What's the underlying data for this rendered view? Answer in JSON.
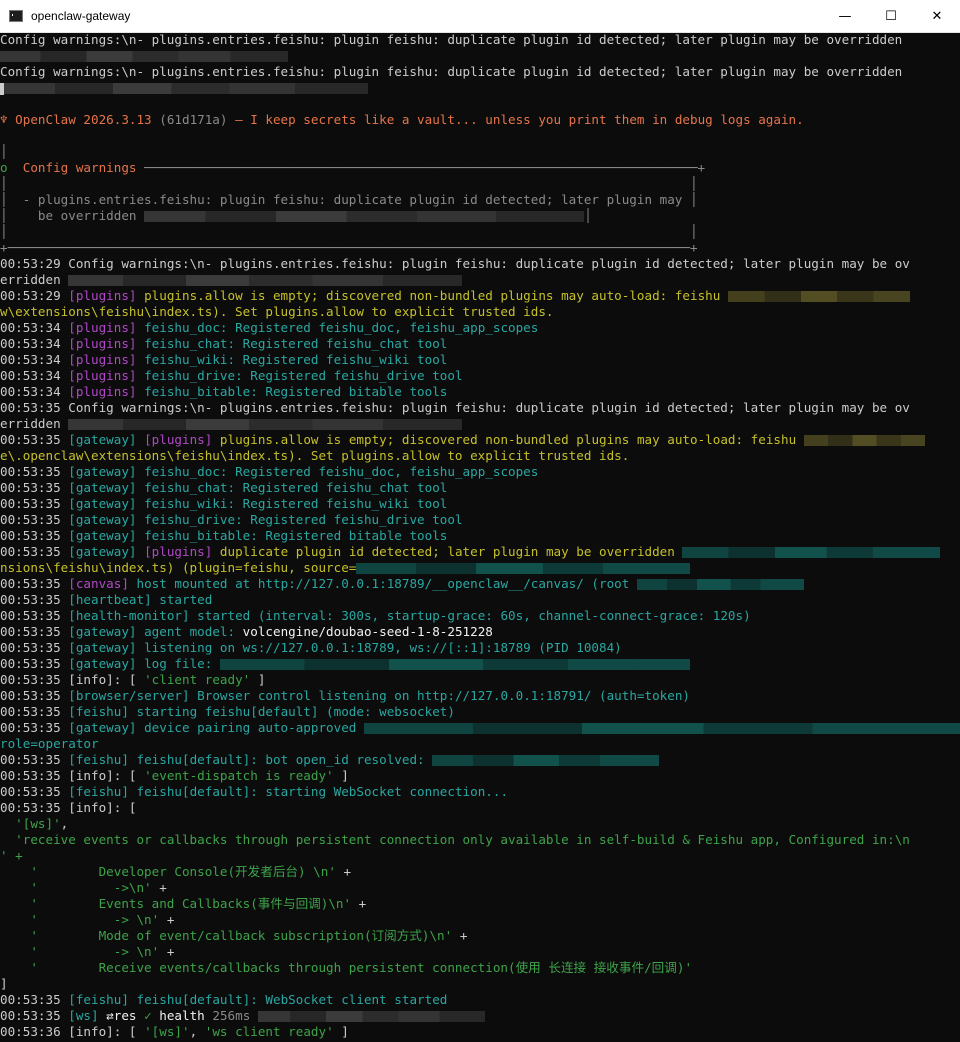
{
  "window": {
    "title": "openclaw-gateway",
    "minimize": "—",
    "maximize": "☐",
    "close": "✕"
  },
  "lines": [
    {
      "segs": [
        {
          "t": "Config warnings:\\n- plugins.entries.feishu: plugin feishu: duplicate plugin id detected; later plugin may be overridden"
        }
      ]
    },
    {
      "segs": [
        {
          "b": 38,
          "c": "gray"
        }
      ]
    },
    {
      "segs": [
        {
          "t": "Config warnings:\\n- plugins.entries.feishu: plugin feishu: duplicate plugin id detected; later plugin may be overridden"
        }
      ]
    },
    {
      "segs": [
        {
          "cursor": true
        },
        {
          "b": 48,
          "c": "gray"
        }
      ]
    },
    {
      "segs": []
    },
    {
      "segs": [
        {
          "t": "♆ OpenClaw 2026.3.13 ",
          "c": "orange"
        },
        {
          "t": "(61d171a)",
          "c": "gray"
        },
        {
          "t": " — I keep secrets like a vault... unless you print them in debug logs again.",
          "c": "orange"
        }
      ]
    },
    {
      "segs": []
    },
    {
      "segs": [
        {
          "t": "│",
          "c": "gray"
        }
      ]
    },
    {
      "segs": [
        {
          "t": "o  ",
          "c": "green"
        },
        {
          "t": "Config warnings",
          "c": "orange"
        },
        {
          "t": " ─────────────────────────────────────────────────────────────────────────+",
          "c": "gray"
        }
      ]
    },
    {
      "segs": [
        {
          "t": "│                                                                                          │",
          "c": "gray"
        }
      ]
    },
    {
      "segs": [
        {
          "t": "│  - plugins.entries.feishu: plugin feishu: duplicate plugin id detected; later plugin may │",
          "c": "gray"
        }
      ]
    },
    {
      "segs": [
        {
          "t": "│    be overridden ",
          "c": "gray"
        },
        {
          "b": 58,
          "c": "gray"
        },
        {
          "t": "│",
          "c": "gray"
        }
      ]
    },
    {
      "segs": [
        {
          "t": "│                                                                                          │",
          "c": "gray"
        }
      ]
    },
    {
      "segs": [
        {
          "t": "+──────────────────────────────────────────────────────────────────────────────────────────+",
          "c": "gray"
        }
      ]
    },
    {
      "segs": [
        {
          "t": "00:53:29 "
        },
        {
          "t": "Config warnings:\\n- plugins.entries.feishu: plugin feishu: duplicate plugin id detected; later plugin may be ov"
        }
      ]
    },
    {
      "segs": [
        {
          "t": "erridden "
        },
        {
          "b": 52,
          "c": "gray"
        }
      ]
    },
    {
      "segs": [
        {
          "t": "00:53:29 "
        },
        {
          "t": "[plugins]",
          "c": "plugins"
        },
        {
          "t": " plugins.allow is empty; discovered non-bundled plugins may auto-load: feishu ",
          "c": "yellow"
        },
        {
          "b": 24,
          "c": "olive"
        }
      ]
    },
    {
      "segs": [
        {
          "t": "w\\extensions\\feishu\\index.ts). Set plugins.allow to explicit trusted ids.",
          "c": "yellow"
        }
      ]
    },
    {
      "segs": [
        {
          "t": "00:53:34 "
        },
        {
          "t": "[plugins]",
          "c": "plugins"
        },
        {
          "t": " feishu_doc: Registered feishu_doc, feishu_app_scopes",
          "c": "gateway"
        }
      ]
    },
    {
      "segs": [
        {
          "t": "00:53:34 "
        },
        {
          "t": "[plugins]",
          "c": "plugins"
        },
        {
          "t": " feishu_chat: Registered feishu_chat tool",
          "c": "gateway"
        }
      ]
    },
    {
      "segs": [
        {
          "t": "00:53:34 "
        },
        {
          "t": "[plugins]",
          "c": "plugins"
        },
        {
          "t": " feishu_wiki: Registered feishu_wiki tool",
          "c": "gateway"
        }
      ]
    },
    {
      "segs": [
        {
          "t": "00:53:34 "
        },
        {
          "t": "[plugins]",
          "c": "plugins"
        },
        {
          "t": " feishu_drive: Registered feishu_drive tool",
          "c": "gateway"
        }
      ]
    },
    {
      "segs": [
        {
          "t": "00:53:34 "
        },
        {
          "t": "[plugins]",
          "c": "plugins"
        },
        {
          "t": " feishu_bitable: Registered bitable tools",
          "c": "gateway"
        }
      ]
    },
    {
      "segs": [
        {
          "t": "00:53:35 "
        },
        {
          "t": "Config warnings:\\n- plugins.entries.feishu: plugin feishu: duplicate plugin id detected; later plugin may be ov"
        }
      ]
    },
    {
      "segs": [
        {
          "t": "erridden "
        },
        {
          "b": 52,
          "c": "gray"
        }
      ]
    },
    {
      "segs": [
        {
          "t": "00:53:35 "
        },
        {
          "t": "[gateway]",
          "c": "gateway"
        },
        {
          "t": " "
        },
        {
          "t": "[plugins]",
          "c": "plugins"
        },
        {
          "t": " plugins.allow is empty; discovered non-bundled plugins may auto-load: feishu ",
          "c": "yellow"
        },
        {
          "b": 16,
          "c": "olive"
        }
      ]
    },
    {
      "segs": [
        {
          "t": "e\\.openclaw\\extensions\\feishu\\index.ts). Set plugins.allow to explicit trusted ids.",
          "c": "yellow"
        }
      ]
    },
    {
      "segs": [
        {
          "t": "00:53:35 "
        },
        {
          "t": "[gateway]",
          "c": "gateway"
        },
        {
          "t": " feishu_doc: Registered feishu_doc, feishu_app_scopes",
          "c": "gateway"
        }
      ]
    },
    {
      "segs": [
        {
          "t": "00:53:35 "
        },
        {
          "t": "[gateway]",
          "c": "gateway"
        },
        {
          "t": " feishu_chat: Registered feishu_chat tool",
          "c": "gateway"
        }
      ]
    },
    {
      "segs": [
        {
          "t": "00:53:35 "
        },
        {
          "t": "[gateway]",
          "c": "gateway"
        },
        {
          "t": " feishu_wiki: Registered feishu_wiki tool",
          "c": "gateway"
        }
      ]
    },
    {
      "segs": [
        {
          "t": "00:53:35 "
        },
        {
          "t": "[gateway]",
          "c": "gateway"
        },
        {
          "t": " feishu_drive: Registered feishu_drive tool",
          "c": "gateway"
        }
      ]
    },
    {
      "segs": [
        {
          "t": "00:53:35 "
        },
        {
          "t": "[gateway]",
          "c": "gateway"
        },
        {
          "t": " feishu_bitable: Registered bitable tools",
          "c": "gateway"
        }
      ]
    },
    {
      "segs": [
        {
          "t": "00:53:35 "
        },
        {
          "t": "[gateway]",
          "c": "gateway"
        },
        {
          "t": " "
        },
        {
          "t": "[plugins]",
          "c": "plugins"
        },
        {
          "t": " duplicate plugin id detected; later plugin may be overridden ",
          "c": "yellow"
        },
        {
          "b": 34,
          "c": "teal"
        }
      ]
    },
    {
      "segs": [
        {
          "t": "nsions\\feishu\\index.ts) (plugin=feishu, source=",
          "c": "yellow"
        },
        {
          "b": 44,
          "c": "teal"
        }
      ]
    },
    {
      "segs": [
        {
          "t": "00:53:35 "
        },
        {
          "t": "[canvas]",
          "c": "plugins"
        },
        {
          "t": " host mounted at http://127.0.0.1:18789/__openclaw__/canvas/ (root ",
          "c": "gateway"
        },
        {
          "b": 22,
          "c": "teal"
        }
      ]
    },
    {
      "segs": [
        {
          "t": "00:53:35 "
        },
        {
          "t": "[heartbeat]",
          "c": "gateway"
        },
        {
          "t": " started",
          "c": "gateway"
        }
      ]
    },
    {
      "segs": [
        {
          "t": "00:53:35 "
        },
        {
          "t": "[health-monitor]",
          "c": "gateway"
        },
        {
          "t": " started (interval: 300s, startup-grace: 60s, channel-connect-grace: 120s)",
          "c": "gateway"
        }
      ]
    },
    {
      "segs": [
        {
          "t": "00:53:35 "
        },
        {
          "t": "[gateway]",
          "c": "gateway"
        },
        {
          "t": " agent model: ",
          "c": "gateway"
        },
        {
          "t": "volcengine/doubao-seed-1-8-251228",
          "c": "white"
        }
      ]
    },
    {
      "segs": [
        {
          "t": "00:53:35 "
        },
        {
          "t": "[gateway]",
          "c": "gateway"
        },
        {
          "t": " listening on ws://127.0.0.1:18789, ws://[::1]:18789 (PID 10084)",
          "c": "gateway"
        }
      ]
    },
    {
      "segs": [
        {
          "t": "00:53:35 "
        },
        {
          "t": "[gateway]",
          "c": "gateway"
        },
        {
          "t": " log file: ",
          "c": "gateway"
        },
        {
          "b": 62,
          "c": "teal"
        }
      ]
    },
    {
      "segs": [
        {
          "t": "00:53:35 "
        },
        {
          "t": "[info]: [ "
        },
        {
          "t": "'client ready'",
          "c": "green"
        },
        {
          "t": " ]"
        }
      ]
    },
    {
      "segs": [
        {
          "t": "00:53:35 "
        },
        {
          "t": "[browser/server]",
          "c": "gateway"
        },
        {
          "t": " Browser control listening on http://127.0.0.1:18791/ (auth=token)",
          "c": "gateway"
        }
      ]
    },
    {
      "segs": [
        {
          "t": "00:53:35 "
        },
        {
          "t": "[feishu]",
          "c": "gateway"
        },
        {
          "t": " starting feishu[default] (mode: websocket)",
          "c": "gateway"
        }
      ]
    },
    {
      "segs": [
        {
          "t": "00:53:35 "
        },
        {
          "t": "[gateway]",
          "c": "gateway"
        },
        {
          "t": " device pairing auto-approved ",
          "c": "gateway"
        },
        {
          "b": 80,
          "c": "teal"
        }
      ]
    },
    {
      "segs": [
        {
          "t": "role=operator",
          "c": "gateway"
        }
      ]
    },
    {
      "segs": [
        {
          "t": "00:53:35 "
        },
        {
          "t": "[feishu]",
          "c": "gateway"
        },
        {
          "t": " feishu[default]: bot open_id resolved: ",
          "c": "gateway"
        },
        {
          "b": 30,
          "c": "teal"
        }
      ]
    },
    {
      "segs": [
        {
          "t": "00:53:35 "
        },
        {
          "t": "[info]: [ "
        },
        {
          "t": "'event-dispatch is ready'",
          "c": "green"
        },
        {
          "t": " ]"
        }
      ]
    },
    {
      "segs": [
        {
          "t": "00:53:35 "
        },
        {
          "t": "[feishu]",
          "c": "gateway"
        },
        {
          "t": " feishu[default]: starting WebSocket connection...",
          "c": "gateway"
        }
      ]
    },
    {
      "segs": [
        {
          "t": "00:53:35 "
        },
        {
          "t": "[info]: ["
        }
      ]
    },
    {
      "segs": [
        {
          "t": "  "
        },
        {
          "t": "'[ws]'",
          "c": "green"
        },
        {
          "t": ","
        }
      ]
    },
    {
      "segs": [
        {
          "t": "  "
        },
        {
          "t": "'receive events or callbacks through persistent connection only available in self-build & Feishu app, Configured in:\\n",
          "c": "green"
        }
      ]
    },
    {
      "segs": [
        {
          "t": "' +",
          "c": "green"
        }
      ]
    },
    {
      "segs": [
        {
          "t": "    '        Developer Console(开发者后台) \\n'",
          "c": "green"
        },
        {
          "t": " +"
        }
      ]
    },
    {
      "segs": [
        {
          "t": "    '          ->\\n'",
          "c": "green"
        },
        {
          "t": " +"
        }
      ]
    },
    {
      "segs": [
        {
          "t": "    '        Events and Callbacks(事件与回调)\\n'",
          "c": "green"
        },
        {
          "t": " +"
        }
      ]
    },
    {
      "segs": [
        {
          "t": "    '          -> \\n'",
          "c": "green"
        },
        {
          "t": " +"
        }
      ]
    },
    {
      "segs": [
        {
          "t": "    '        Mode of event/callback subscription(订阅方式)\\n'",
          "c": "green"
        },
        {
          "t": " +"
        }
      ]
    },
    {
      "segs": [
        {
          "t": "    '          -> \\n'",
          "c": "green"
        },
        {
          "t": " +"
        }
      ]
    },
    {
      "segs": [
        {
          "t": "    '        Receive events/callbacks through persistent connection(使用 长连接 接收事件/回调)'",
          "c": "green"
        }
      ]
    },
    {
      "segs": [
        {
          "t": "]"
        }
      ]
    },
    {
      "segs": [
        {
          "t": "00:53:35 "
        },
        {
          "t": "[feishu]",
          "c": "gateway"
        },
        {
          "t": " feishu[default]: WebSocket client started",
          "c": "gateway"
        }
      ]
    },
    {
      "segs": [
        {
          "t": "00:53:35 "
        },
        {
          "t": "[ws]",
          "c": "gateway"
        },
        {
          "t": " ⇄res ",
          "c": "white"
        },
        {
          "t": "✓",
          "c": "green"
        },
        {
          "t": " health ",
          "c": "white"
        },
        {
          "t": "256ms",
          "c": "gray"
        },
        {
          "t": " "
        },
        {
          "b": 30,
          "c": "gray"
        }
      ]
    },
    {
      "segs": [
        {
          "t": "00:53:36 "
        },
        {
          "t": "[info]: [ "
        },
        {
          "t": "'[ws]'",
          "c": "green"
        },
        {
          "t": ", "
        },
        {
          "t": "'ws client ready'",
          "c": "green"
        },
        {
          "t": " ]"
        }
      ]
    }
  ]
}
